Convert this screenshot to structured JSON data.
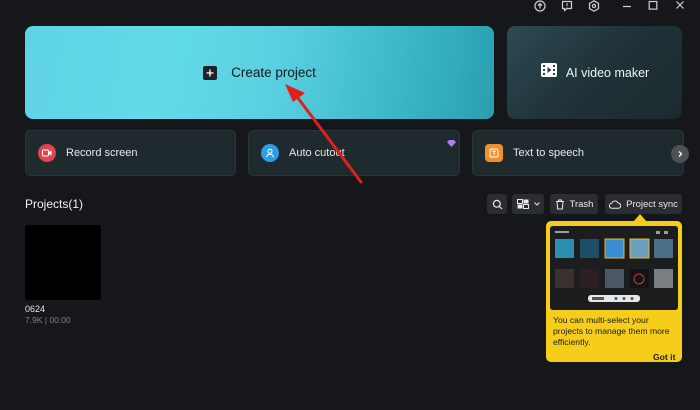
{
  "titlebar": {
    "icons": [
      "upload-icon",
      "feedback-icon",
      "settings-icon",
      "minimize-icon",
      "maximize-icon",
      "close-icon"
    ]
  },
  "hero": {
    "create_label": "Create project",
    "ai_label": "AI video maker"
  },
  "quick_actions": [
    {
      "label": "Record screen",
      "icon": "record-icon",
      "color": "#e0454f"
    },
    {
      "label": "Auto cutout",
      "icon": "person-icon",
      "color": "#2b9ee8"
    },
    {
      "label": "Text to speech",
      "icon": "tts-icon",
      "color": "#f0912a"
    }
  ],
  "projects": {
    "title": "Projects(1)",
    "trash_label": "Trash",
    "sync_label": "Project sync",
    "items": [
      {
        "name": "0624",
        "meta": "7.9K | 00:00"
      }
    ]
  },
  "tooltip": {
    "text": "You can multi-select your projects to manage them more efficiently.",
    "button": "Got it"
  },
  "colors": {
    "background": "#15171a",
    "tooltip": "#f5cd1a",
    "arrow": "#e0201c"
  }
}
